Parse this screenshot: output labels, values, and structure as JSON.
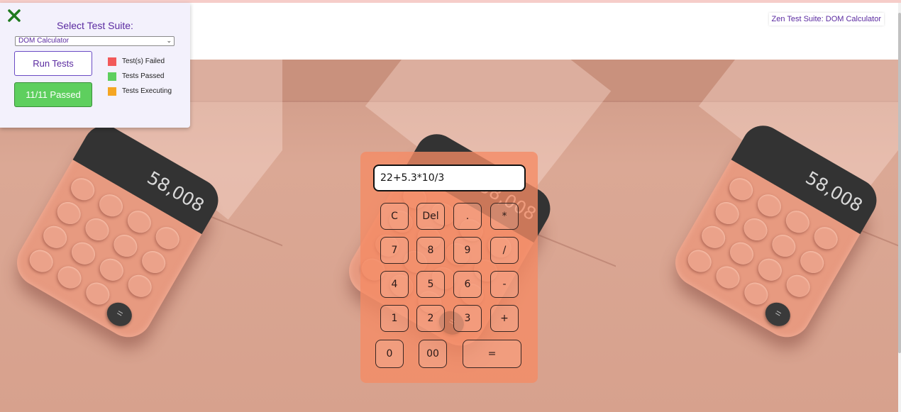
{
  "page": {
    "suite_label": "Zen Test Suite: DOM Calculator"
  },
  "test_panel": {
    "select_title": "Select Test Suite:",
    "selected_suite": "DOM Calculator",
    "run_button": "Run Tests",
    "status": "11/11 Passed",
    "legend": [
      {
        "label": "Test(s) Failed",
        "color": "#f25a5a"
      },
      {
        "label": "Tests Passed",
        "color": "#5ecf5e"
      },
      {
        "label": "Tests Executing",
        "color": "#f5a623"
      }
    ]
  },
  "background": {
    "device_display": "58,008",
    "device_equals": "="
  },
  "calculator": {
    "display": "22+5.3*10/3",
    "keys": {
      "clear": "C",
      "delete": "Del",
      "decimal": ".",
      "multiply": "*",
      "seven": "7",
      "eight": "8",
      "nine": "9",
      "divide": "/",
      "four": "4",
      "five": "5",
      "six": "6",
      "minus": "-",
      "one": "1",
      "two": "2",
      "three": "3",
      "plus": "+",
      "zero": "0",
      "double_zero": "00",
      "equals": "="
    }
  },
  "colors": {
    "accent": "#5a2aa0",
    "success": "#5ecf5e",
    "close_icon": "#1f7a1f",
    "calculator_bg": "#f58a64"
  },
  "icons": {
    "close": "close-icon",
    "dropdown": "chevron-down-icon"
  }
}
